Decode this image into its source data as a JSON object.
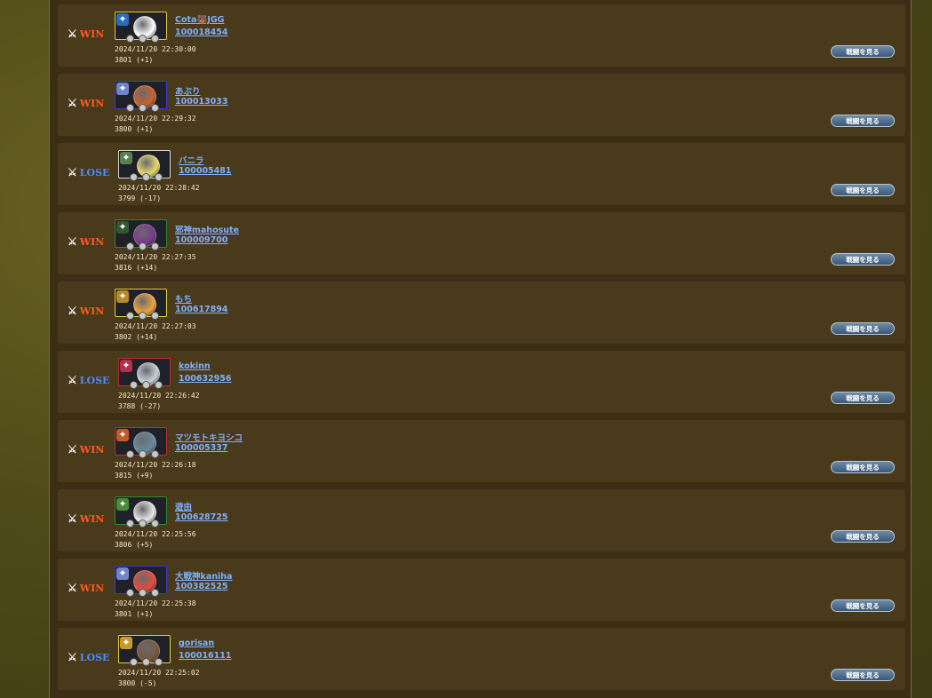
{
  "watch_button_label": "戦闘を見る",
  "battles": [
    {
      "result": "WIN",
      "name": "Cota&#9763;JGG",
      "uid": "100018454",
      "time": "2024/11/20 22:30:00",
      "score": "3801 (+1)",
      "frame": "#e6c93a",
      "orb": "#ffffff",
      "crest": "#2b6dba"
    },
    {
      "result": "WIN",
      "name": "あぶり",
      "uid": "100013033",
      "time": "2024/11/20 22:29:32",
      "score": "3800 (+1)",
      "frame": "#3b3bd1",
      "orb": "#c9622a",
      "crest": "#6e86c9"
    },
    {
      "result": "LOSE",
      "name": "バニラ",
      "uid": "100005481",
      "time": "2024/11/20 22:28:42",
      "score": "3799 (-17)",
      "frame": "#d8d8d8",
      "orb": "#e8d96a",
      "crest": "#5a7e52"
    },
    {
      "result": "WIN",
      "name": "邪神mahosute",
      "uid": "100009700",
      "time": "2024/11/20 22:27:35",
      "score": "3816 (+14)",
      "frame": "#2e8a2e",
      "orb": "#7a3a8a",
      "crest": "#2f5a2f"
    },
    {
      "result": "WIN",
      "name": "もち",
      "uid": "100617894",
      "time": "2024/11/20 22:27:03",
      "score": "3802 (+14)",
      "frame": "#e6d23a",
      "orb": "#f0a43a",
      "crest": "#b78a2a"
    },
    {
      "result": "LOSE",
      "name": "kokinn",
      "uid": "100632956",
      "time": "2024/11/20 22:26:42",
      "score": "3788 (-27)",
      "frame": "#c03030",
      "orb": "#c8d0d8",
      "crest": "#b03050"
    },
    {
      "result": "WIN",
      "name": "マツモトキヨシコ",
      "uid": "100005337",
      "time": "2024/11/20 22:26:18",
      "score": "3815 (+9)",
      "frame": "#c03030",
      "orb": "#6a8a9a",
      "crest": "#c25a2a"
    },
    {
      "result": "WIN",
      "name": "遊由",
      "uid": "100628725",
      "time": "2024/11/20 22:25:56",
      "score": "3806 (+5)",
      "frame": "#2e8a2e",
      "orb": "#e8e8e8",
      "crest": "#4a8a3a"
    },
    {
      "result": "WIN",
      "name": "大戦神kaniha",
      "uid": "100382525",
      "time": "2024/11/20 22:25:38",
      "score": "3801 (+1)",
      "frame": "#3b3bd1",
      "orb": "#e84a3a",
      "crest": "#6e86c9"
    },
    {
      "result": "LOSE",
      "name": "gorisan",
      "uid": "100016111",
      "time": "2024/11/20 22:25:02",
      "score": "3800 (-5)",
      "frame": "#e6d23a",
      "orb": "#7a5a3a",
      "crest": "#c89a2a"
    }
  ]
}
